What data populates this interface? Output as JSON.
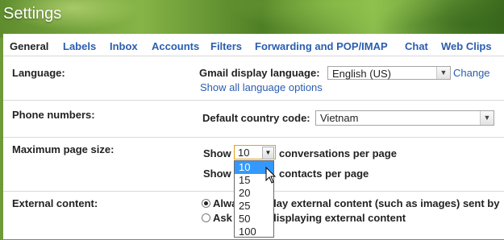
{
  "header": {
    "title": "Settings"
  },
  "tabs": [
    "General",
    "Labels",
    "Inbox",
    "Accounts",
    "Filters",
    "Forwarding and POP/IMAP",
    "Chat",
    "Web Clips"
  ],
  "language": {
    "label": "Language:",
    "display_label": "Gmail display language:",
    "value": "English (US)",
    "change_link": "Change",
    "show_all_link": "Show all language options"
  },
  "phone": {
    "label": "Phone numbers:",
    "country_label": "Default country code:",
    "value": "Vietnam"
  },
  "page_size": {
    "label": "Maximum page size:",
    "show1": "Show",
    "selected": "10",
    "conv_suffix": "conversations per page",
    "show2": "Show",
    "contacts_suffix": "contacts per page",
    "options": [
      "10",
      "15",
      "20",
      "25",
      "50",
      "100"
    ]
  },
  "external": {
    "label": "External content:",
    "opt1": "Always display external content (such as images) sent by",
    "opt2": "Ask before displaying external content"
  },
  "colors": {
    "link": "#2a5db0",
    "highlight": "#3399ff"
  }
}
